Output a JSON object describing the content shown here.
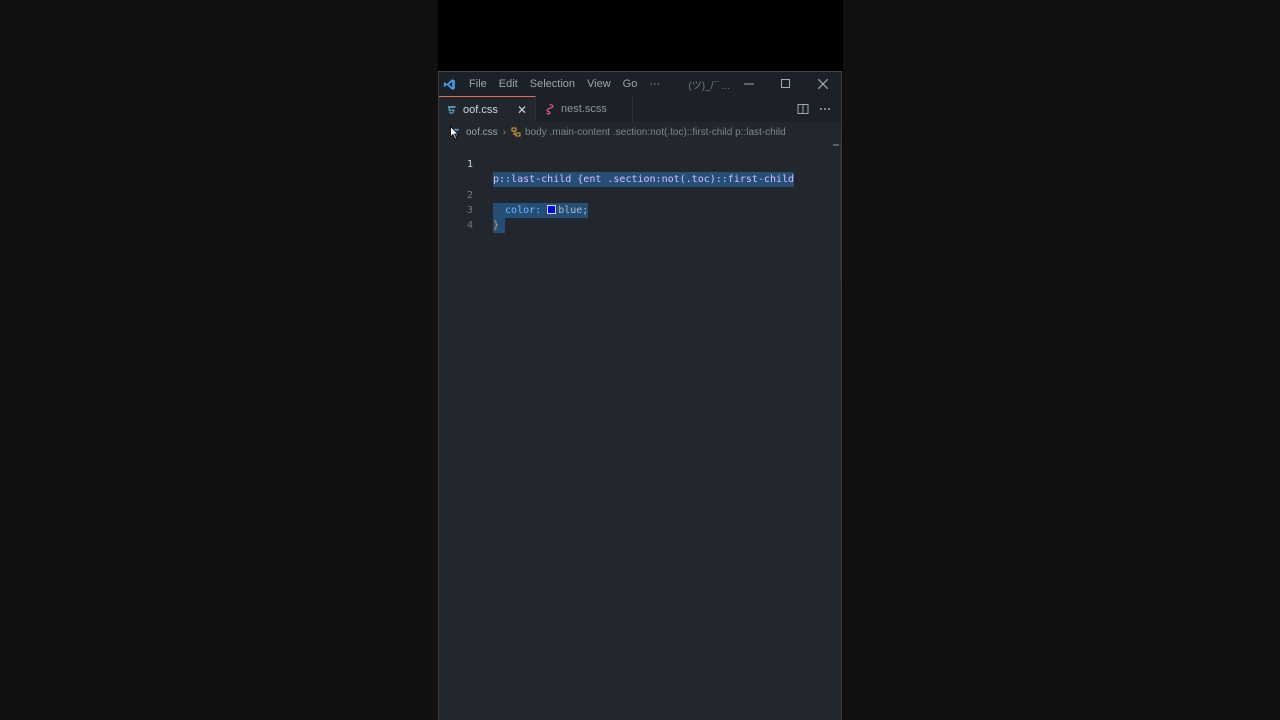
{
  "window": {
    "title": "(ツ)_/¯ ...",
    "menu": [
      "File",
      "Edit",
      "Selection",
      "View",
      "Go"
    ],
    "menu_more": "···"
  },
  "tabs": [
    {
      "label": "oof.css",
      "icon": "css-file-icon",
      "active": true,
      "close": "✕"
    },
    {
      "label": "nest.scss",
      "icon": "scss-file-icon",
      "active": false
    }
  ],
  "breadcrumb": {
    "file": "oof.css",
    "symbol": "body .main-content .section:not(.toc)::first-child p::last-child"
  },
  "editor": {
    "line_numbers": [
      "1",
      "2",
      "3",
      "4"
    ],
    "lines": {
      "l1a": "body .main-content .section:not(.toc)::first-child",
      "l1b": "p::last-child {",
      "l2_prop": "  color:",
      "l2_val": "blue;",
      "l3": "}"
    },
    "color_swatch": "#0000ff"
  },
  "colors": {
    "accent_tab_border": "#e36f4f",
    "selection": "#264f78",
    "editor_bg": "#22272e"
  }
}
